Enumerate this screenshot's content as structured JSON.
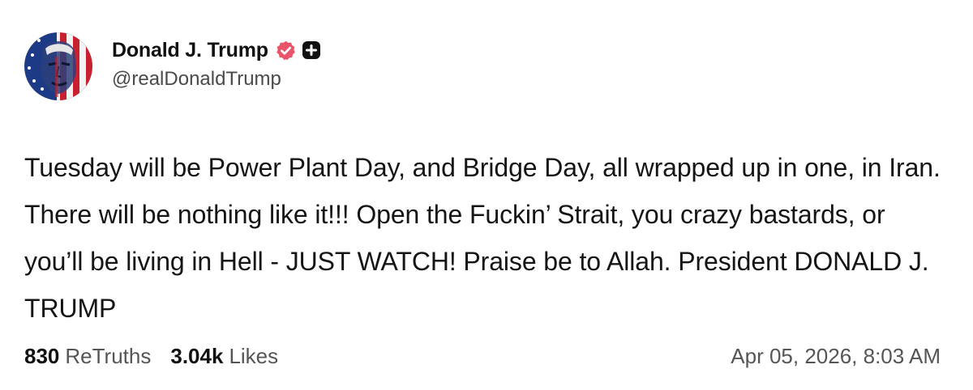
{
  "author": {
    "display_name": "Donald J. Trump",
    "handle": "@realDonaldTrump",
    "verified_color": "#e8546a"
  },
  "post": {
    "text": "Tuesday will be Power Plant Day, and Bridge Day, all wrapped up in one, in Iran. There will be nothing like it!!! Open the Fuckin’ Strait, you crazy bastards, or you’ll be living in Hell - JUST WATCH! Praise be to Allah. President DONALD J. TRUMP"
  },
  "stats": {
    "retruths_count": "830",
    "retruths_label": "ReTruths",
    "likes_count": "3.04k",
    "likes_label": "Likes"
  },
  "timestamp": "Apr 05, 2026, 8:03 AM",
  "icons": {
    "verified": "verified-badge-icon",
    "plus": "plus-badge-icon"
  }
}
